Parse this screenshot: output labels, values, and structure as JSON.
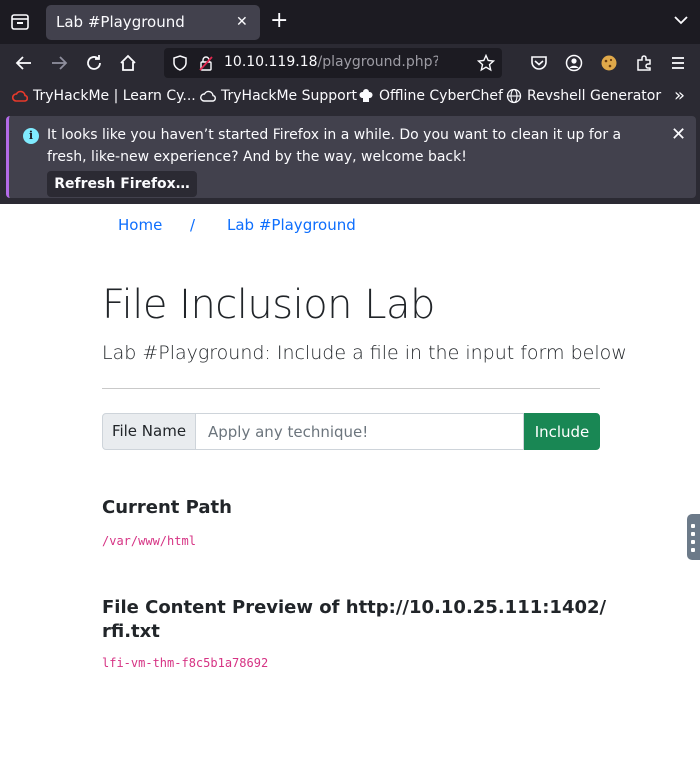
{
  "browser": {
    "tab": {
      "title": "Lab #Playground",
      "close_label": "✕"
    },
    "new_tab_label": "+",
    "url": {
      "host": "10.10.119.18",
      "path": "/playground.php?file=ht"
    },
    "bookmarks": [
      {
        "label": "TryHackMe | Learn Cy...",
        "icon": "tryhackme-icon"
      },
      {
        "label": "TryHackMe Support",
        "icon": "support-cloud-icon"
      },
      {
        "label": "Offline CyberChef",
        "icon": "chef-icon"
      },
      {
        "label": "Revshell Generator",
        "icon": "globe-icon"
      }
    ],
    "overflow_label": "»",
    "notification": {
      "text": "It looks like you haven’t started Firefox in a while. Do you want to clean it up for a fresh, like-new experience? And by the way, welcome back!",
      "button_label": "Refresh Firefox…",
      "close_label": "✕"
    }
  },
  "page": {
    "breadcrumb": {
      "home": "Home",
      "separator": "/",
      "current": "Lab #Playground"
    },
    "title": "File Inclusion Lab",
    "subtitle": "Lab #Playground: Include a file in the input form below",
    "form": {
      "label": "File Name",
      "placeholder": "Apply any technique!",
      "button_label": "Include"
    },
    "current_path": {
      "heading": "Current Path",
      "value": "/var/www/html"
    },
    "preview": {
      "heading_prefix": "File Content Preview of ",
      "heading_url_line1": "http://10.10.25.111:1402/",
      "heading_url_line2": "rfi.txt",
      "content": "lfi-vm-thm-f8c5b1a78692"
    }
  },
  "colors": {
    "link": "#0d6efd",
    "success_button": "#198754",
    "code": "#d63384",
    "chrome_dark": "#1c1b22",
    "chrome_mid": "#2b2a33"
  }
}
